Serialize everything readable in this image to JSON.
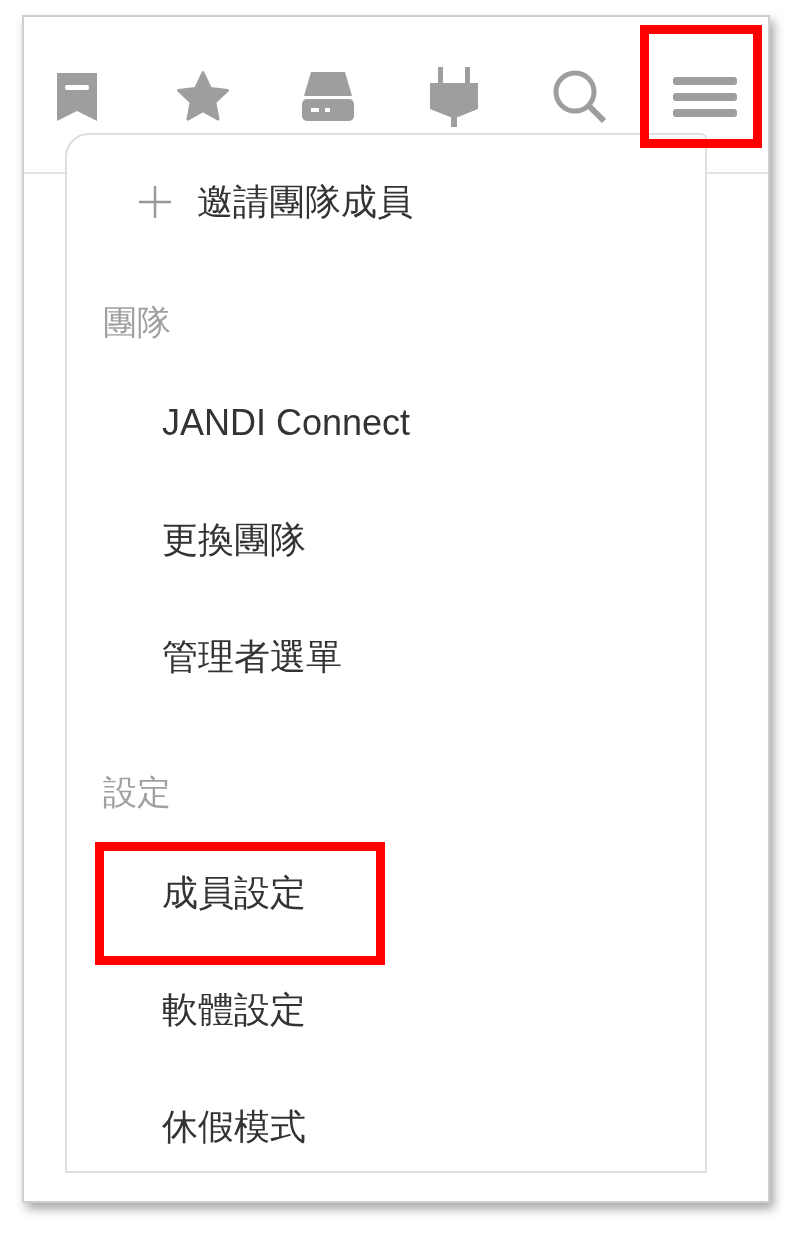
{
  "toolbar": {
    "buttons": [
      {
        "kind": "bookmark",
        "highlighted": false
      },
      {
        "kind": "star",
        "highlighted": false
      },
      {
        "kind": "drive",
        "highlighted": false
      },
      {
        "kind": "plug",
        "highlighted": false
      },
      {
        "kind": "search",
        "highlighted": false
      },
      {
        "kind": "menu",
        "highlighted": true
      }
    ]
  },
  "menu": {
    "invite": {
      "label": "邀請團隊成員"
    },
    "sections": [
      {
        "title": "團隊",
        "items": [
          {
            "label": "JANDI Connect",
            "highlighted": false
          },
          {
            "label": "更換團隊",
            "highlighted": false
          },
          {
            "label": "管理者選單",
            "highlighted": false
          }
        ]
      },
      {
        "title": "設定",
        "items": [
          {
            "label": "成員設定",
            "highlighted": true
          },
          {
            "label": "軟體設定",
            "highlighted": false
          },
          {
            "label": "休假模式",
            "highlighted": false
          }
        ]
      }
    ]
  }
}
